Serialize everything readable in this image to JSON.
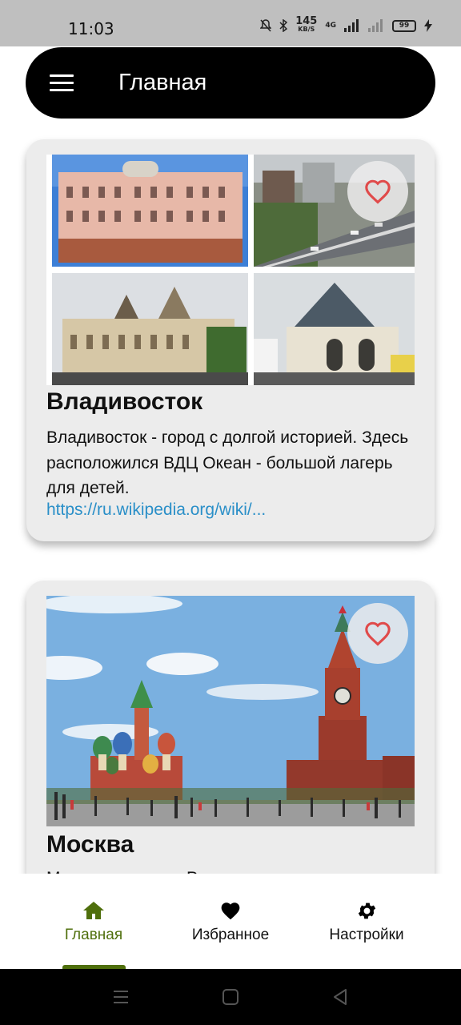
{
  "status_bar": {
    "time": "11:03",
    "net_speed_value": "145",
    "net_speed_unit": "KB/S",
    "network_label": "4G",
    "battery": "99"
  },
  "app_bar": {
    "title": "Главная",
    "menu_icon": "hamburger-menu-icon"
  },
  "cards": [
    {
      "title": "Владивосток",
      "description": "Владивосток - город с долгой историей. Здесь расположился ВДЦ Океан - большой лагерь для детей.",
      "link": "https://ru.wikipedia.org/wiki/...",
      "favorite_icon": "heart-outline-icon",
      "image": "vladivostok-collage"
    },
    {
      "title": "Москва",
      "description": "Москва - столица России",
      "favorite_icon": "heart-outline-icon",
      "image": "moscow-red-square"
    }
  ],
  "bottom_nav": {
    "items": [
      {
        "label": "Главная",
        "icon": "home-icon",
        "active": true
      },
      {
        "label": "Избранное",
        "icon": "heart-icon",
        "active": false
      },
      {
        "label": "Настройки",
        "icon": "gear-icon",
        "active": false
      }
    ]
  },
  "colors": {
    "app_bar_bg": "#000000",
    "card_bg": "#ececec",
    "accent_active": "#4f6f0c",
    "link": "#2a8fc8",
    "favorite_heart": "#e04a4a"
  }
}
